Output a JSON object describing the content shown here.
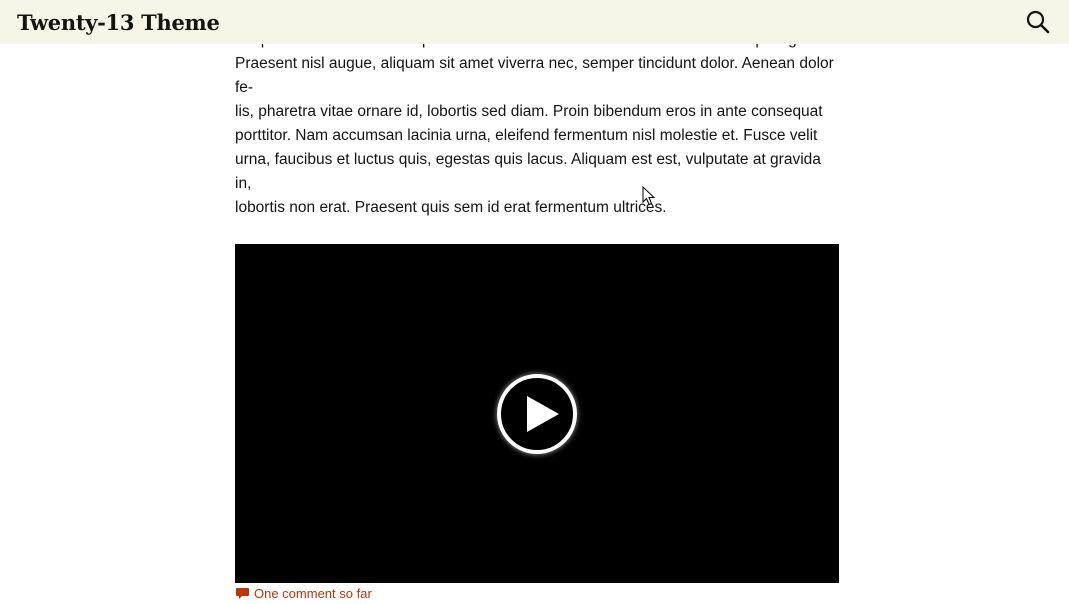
{
  "header": {
    "site_title": "Twenty-13 Theme",
    "search_icon": "search-icon",
    "background_color": "#f7f5e7"
  },
  "entry": {
    "body_text": "tesque habitant morbi tristique senectus et netus et malesuada fames ac turpis egestas.\nPraesent nisl augue, aliquam sit amet viverra nec, semper tincidunt dolor. Aenean dolor fe-\nlis, pharetra vitae ornare id, lobortis sed diam. Proin bibendum eros in ante consequat\nporttitor. Nam accumsan lacinia urna, eleifend fermentum nisl molestie et. Fusce velit\nurna, faucibus et luctus quis, egestas quis lacus. Aliquam est est, vulputate at gravida in,\nlobortis non erat. Praesent quis sem id erat fermentum ultrices."
  },
  "video": {
    "play_icon": "play-icon",
    "background_color": "#000000"
  },
  "comments": {
    "link_text": "One comment so far",
    "icon": "comment-icon",
    "color": "#bc360a"
  }
}
